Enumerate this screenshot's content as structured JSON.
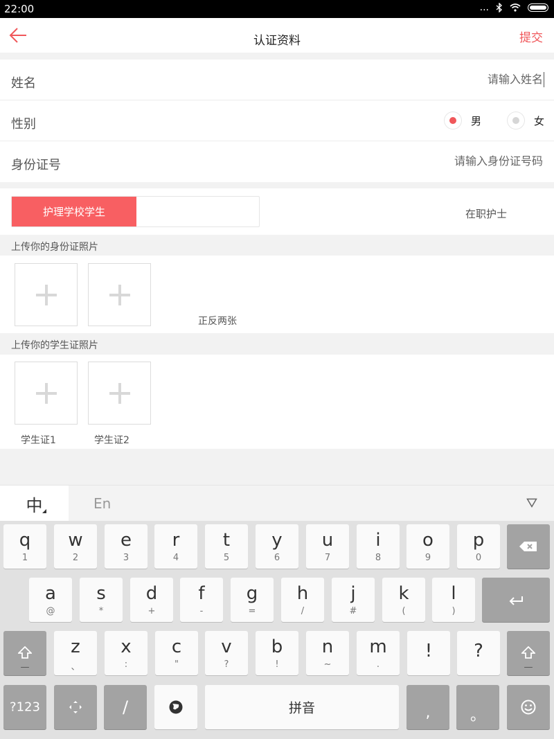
{
  "status": {
    "time": "22:00",
    "dots": "..."
  },
  "header": {
    "title": "认证资料",
    "submit_label": "提交"
  },
  "form": {
    "name_label": "姓名",
    "name_placeholder": "请输入姓名",
    "gender_label": "性别",
    "gender_male": "男",
    "gender_female": "女",
    "gender_selected": "男",
    "id_label": "身份证号",
    "id_placeholder": "请输入身份证号码"
  },
  "segment": {
    "active": "护理学校学生",
    "other": "在职护士"
  },
  "id_photos": {
    "title": "上传你的身份证照片",
    "hint": "正反两张"
  },
  "student_photos": {
    "title": "上传你的学生证照片",
    "caption1": "学生证1",
    "caption2": "学生证2"
  },
  "keyboard": {
    "tab_zh": "中",
    "tab_en": "En",
    "row1": [
      {
        "k": "q",
        "s": "1"
      },
      {
        "k": "w",
        "s": "2"
      },
      {
        "k": "e",
        "s": "3"
      },
      {
        "k": "r",
        "s": "4"
      },
      {
        "k": "t",
        "s": "5"
      },
      {
        "k": "y",
        "s": "6"
      },
      {
        "k": "u",
        "s": "7"
      },
      {
        "k": "i",
        "s": "8"
      },
      {
        "k": "o",
        "s": "9"
      },
      {
        "k": "p",
        "s": "0"
      }
    ],
    "row2": [
      {
        "k": "a",
        "s": "@"
      },
      {
        "k": "s",
        "s": "*"
      },
      {
        "k": "d",
        "s": "+"
      },
      {
        "k": "f",
        "s": "-"
      },
      {
        "k": "g",
        "s": "="
      },
      {
        "k": "h",
        "s": "/"
      },
      {
        "k": "j",
        "s": "#"
      },
      {
        "k": "k",
        "s": "("
      },
      {
        "k": "l",
        "s": ")"
      }
    ],
    "row3": [
      {
        "k": "z",
        "s": "、"
      },
      {
        "k": "x",
        "s": ":"
      },
      {
        "k": "c",
        "s": "\""
      },
      {
        "k": "v",
        "s": "?"
      },
      {
        "k": "b",
        "s": "!"
      },
      {
        "k": "n",
        "s": "~"
      },
      {
        "k": "m",
        "s": "."
      },
      {
        "k": "!",
        "s": ""
      },
      {
        "k": "?",
        "s": ""
      }
    ],
    "symbols_label": "?123",
    "slash_label": "/",
    "space_label": "拼音",
    "comma_label": ",",
    "period_label": "。",
    "shift_sub": "—"
  }
}
